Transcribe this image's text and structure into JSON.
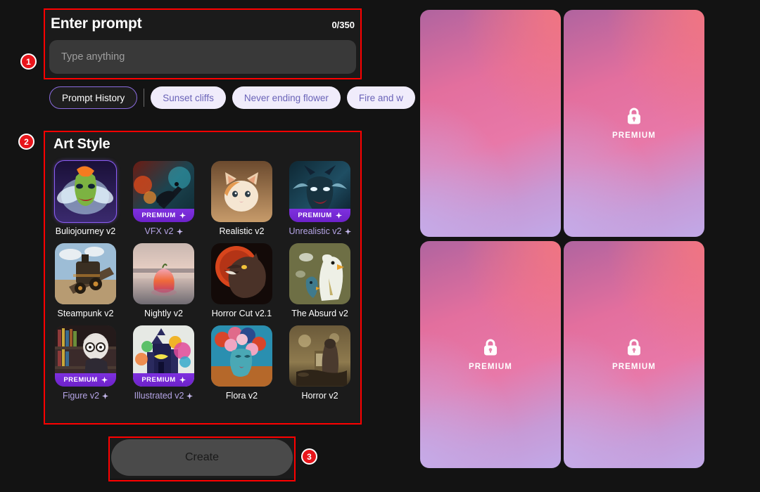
{
  "prompt": {
    "title": "Enter prompt",
    "counter": "0/350",
    "placeholder": "Type anything",
    "value": ""
  },
  "chips": {
    "history_label": "Prompt History",
    "suggestions": [
      {
        "label": "Sunset cliffs"
      },
      {
        "label": "Never ending flower"
      },
      {
        "label": "Fire and w"
      }
    ]
  },
  "art_style": {
    "title": "Art Style",
    "items": [
      {
        "label": "Buliojourney v2",
        "premium": false,
        "selected": true,
        "sparkle": false,
        "badge_text": ""
      },
      {
        "label": "VFX v2",
        "premium": true,
        "selected": false,
        "sparkle": true,
        "badge_text": "PREMIUM"
      },
      {
        "label": "Realistic v2",
        "premium": false,
        "selected": false,
        "sparkle": false,
        "badge_text": ""
      },
      {
        "label": "Unrealistic v2",
        "premium": true,
        "selected": false,
        "sparkle": true,
        "badge_text": "PREMIUM"
      },
      {
        "label": "Steampunk v2",
        "premium": false,
        "selected": false,
        "sparkle": false,
        "badge_text": ""
      },
      {
        "label": "Nightly v2",
        "premium": false,
        "selected": false,
        "sparkle": false,
        "badge_text": ""
      },
      {
        "label": "Horror Cut v2.1",
        "premium": false,
        "selected": false,
        "sparkle": false,
        "badge_text": ""
      },
      {
        "label": "The Absurd v2",
        "premium": false,
        "selected": false,
        "sparkle": false,
        "badge_text": ""
      },
      {
        "label": "Figure v2",
        "premium": true,
        "selected": false,
        "sparkle": true,
        "badge_text": "PREMIUM"
      },
      {
        "label": "Illustrated v2",
        "premium": true,
        "selected": false,
        "sparkle": true,
        "badge_text": "PREMIUM"
      },
      {
        "label": "Flora v2",
        "premium": false,
        "selected": false,
        "sparkle": false,
        "badge_text": ""
      },
      {
        "label": "Horror v2",
        "premium": false,
        "selected": false,
        "sparkle": false,
        "badge_text": ""
      }
    ]
  },
  "create": {
    "label": "Create"
  },
  "results": {
    "cards": [
      {
        "locked": false,
        "label": ""
      },
      {
        "locked": true,
        "label": "PREMIUM"
      },
      {
        "locked": true,
        "label": "PREMIUM"
      },
      {
        "locked": true,
        "label": "PREMIUM"
      }
    ]
  },
  "annotations": {
    "badges": [
      {
        "number": "1"
      },
      {
        "number": "2"
      },
      {
        "number": "3"
      }
    ]
  },
  "colors": {
    "accent_purple": "#8b5cf6",
    "premium_badge": "#7e30df",
    "annotation_red": "#ff0000",
    "badge_red": "#e8151b",
    "panel_bg": "#1b1b1b",
    "page_bg": "#131313",
    "card_gradient_start": "#b0649f",
    "card_gradient_mid": "#e878a8",
    "card_gradient_end": "#c1a9e8"
  }
}
